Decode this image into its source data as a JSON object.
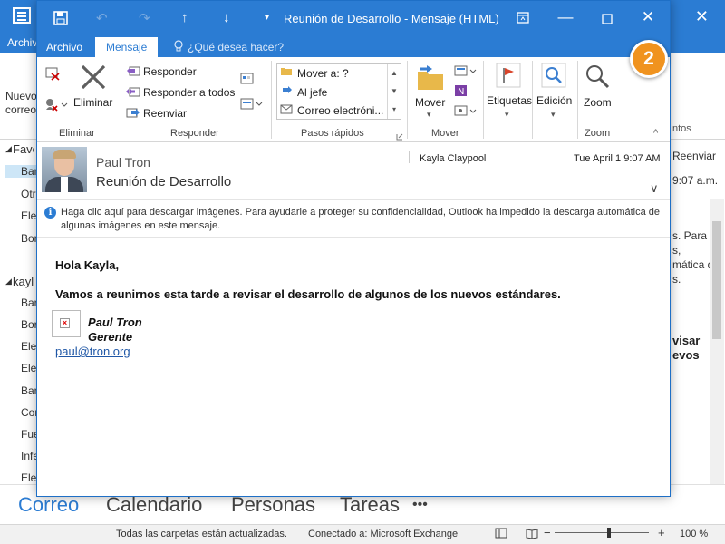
{
  "background": {
    "ribbon_tab_archivo": "Archivo",
    "nuevo_label": "Nuevo",
    "nuevo_sub": "correo",
    "folders": [
      {
        "label": "Favoritos",
        "type": "header"
      },
      {
        "label": "Bandeja",
        "type": "selected"
      },
      {
        "label": "Otros",
        "type": "item"
      },
      {
        "label": "Elementos",
        "type": "item"
      },
      {
        "label": "Borradores",
        "type": "item"
      },
      {
        "label": "kayla",
        "type": "header"
      },
      {
        "label": "Bandeja",
        "type": "item"
      },
      {
        "label": "Borradores",
        "type": "item"
      },
      {
        "label": "Elementos",
        "type": "item"
      },
      {
        "label": "Elementos",
        "type": "item"
      },
      {
        "label": "Bandeja",
        "type": "item"
      },
      {
        "label": "Correo",
        "type": "item"
      },
      {
        "label": "Fuentes",
        "type": "item"
      },
      {
        "label": "Infected",
        "type": "item"
      },
      {
        "label": "Elementos",
        "type": "item"
      }
    ],
    "right_pane": {
      "group_label": "ntos",
      "reenviar": "Reenviar",
      "time": "9:07 a.m.",
      "snippet_lines": [
        "s. Para",
        "s,",
        "mática de",
        "s."
      ],
      "bold_lines": [
        "visar",
        "evos"
      ]
    },
    "nav": [
      "Correo",
      "Calendario",
      "Personas",
      "Tareas",
      "•••"
    ],
    "status": {
      "left": "Todas las carpetas están actualizadas.",
      "connection": "Conectado a: Microsoft Exchange",
      "zoom": "100 %"
    }
  },
  "message_window": {
    "title": "Reunión de Desarrollo - Mensaje (HTML)",
    "tabs": {
      "archivo": "Archivo",
      "mensaje": "Mensaje"
    },
    "tell_me": "¿Qué desea hacer?",
    "ribbon": {
      "eliminar": {
        "button": "Eliminar",
        "group": "Eliminar"
      },
      "responder": {
        "reply": "Responder",
        "reply_all": "Responder a todos",
        "forward": "Reenviar",
        "group": "Responder"
      },
      "quick_steps": {
        "items": [
          "Mover a: ?",
          "Al jefe",
          "Correo electróni..."
        ],
        "group": "Pasos rápidos"
      },
      "mover": {
        "button": "Mover",
        "group": "Mover"
      },
      "etiquetas": {
        "button": "Etiquetas"
      },
      "edicion": {
        "button": "Edición"
      },
      "zoom": {
        "button": "Zoom",
        "group": "Zoom"
      }
    },
    "header": {
      "sender": "Paul Tron",
      "subject": "Reunión de Desarrollo",
      "recipient": "Kayla Claypool",
      "datetime": "Tue April 1 9:07 AM"
    },
    "info_bar": "Haga clic aquí para descargar imágenes. Para ayudarle a proteger su confidencialidad, Outlook ha impedido la descarga automática de algunas imágenes en este mensaje.",
    "body": {
      "greeting": "Hola Kayla,",
      "text": "Vamos a reunirnos esta tarde a revisar el desarrollo de algunos de los nuevos estándares.",
      "sig_name": "Paul Tron",
      "sig_title": "Gerente",
      "email": "paul@tron.org"
    }
  },
  "callout": {
    "number": "2",
    "color": "#f0931f"
  },
  "colors": {
    "accent": "#2b7cd3",
    "link": "#1f57a6"
  }
}
